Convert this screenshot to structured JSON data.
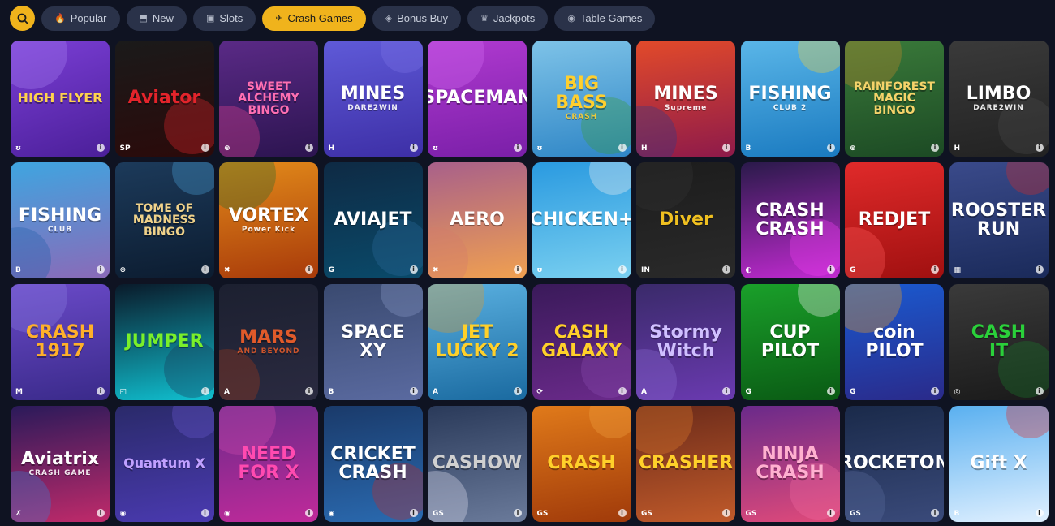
{
  "toolbar": {
    "search_icon": "search-icon",
    "tabs": [
      {
        "label": "Popular",
        "icon": "flame-icon",
        "glyph": "🔥",
        "active": false
      },
      {
        "label": "New",
        "icon": "new-badge-icon",
        "glyph": "⬒",
        "active": false
      },
      {
        "label": "Slots",
        "icon": "slots-icon",
        "glyph": "▣",
        "active": false
      },
      {
        "label": "Crash Games",
        "icon": "plane-icon",
        "glyph": "✈",
        "active": true
      },
      {
        "label": "Bonus Buy",
        "icon": "bonus-icon",
        "glyph": "◈",
        "active": false
      },
      {
        "label": "Jackpots",
        "icon": "jackpot-icon",
        "glyph": "♛",
        "active": false
      },
      {
        "label": "Table Games",
        "icon": "table-icon",
        "glyph": "◉",
        "active": false
      }
    ],
    "accent": "#f0b31c"
  },
  "games": [
    {
      "title": "HIGH FLYER",
      "provider": "ʊ",
      "bg": "linear-gradient(160deg,#7b3fd6,#4b1f99)",
      "fg": "#ffd34d",
      "deco": "#a57ff2"
    },
    {
      "title": "Aviator",
      "sub": "",
      "provider": "SP",
      "bg": "linear-gradient(170deg,#1a1a1a,#2b0a0a)",
      "fg": "#e3242b",
      "deco": "#e3242b"
    },
    {
      "title": "SWEET\nALCHEMY\nBINGO",
      "provider": "⊛",
      "bg": "linear-gradient(170deg,#5a2a86,#2c1450)",
      "fg": "#ff6fb2",
      "deco": "#e84393"
    },
    {
      "title": "MINES",
      "sub": "DARE2WIN",
      "provider": "H",
      "bg": "linear-gradient(170deg,#5f5ad8,#3d2fa6)",
      "fg": "#ffffff",
      "deco": "#7a74e6"
    },
    {
      "title": "SPACEMAN",
      "provider": "ʊ",
      "bg": "linear-gradient(170deg,#b03ad0,#7a1fa8)",
      "fg": "#ffffff",
      "deco": "#d06af0"
    },
    {
      "title": "BIG BASS",
      "sub": "CRASH",
      "provider": "ʊ",
      "bg": "linear-gradient(170deg,#7ec3e8,#2f86c6)",
      "fg": "#ffcf2e",
      "deco": "#3a9a3a"
    },
    {
      "title": "MINES",
      "sub": "Supreme",
      "provider": "H",
      "bg": "linear-gradient(170deg,#e24a2a,#8e1a4a)",
      "fg": "#ffffff",
      "deco": "#2a3a8a"
    },
    {
      "title": "FISHING",
      "sub": "CLUB 2",
      "provider": "B",
      "bg": "linear-gradient(170deg,#5ab6e8,#1a7ac0)",
      "fg": "#ffffff",
      "deco": "#f3d13a"
    },
    {
      "title": "RAINFOREST\nMAGIC\nBINGO",
      "provider": "⊛",
      "bg": "linear-gradient(170deg,#3a7a3a,#1c4a24)",
      "fg": "#f5d36a",
      "deco": "#c48a2a"
    },
    {
      "title": "LIMBO",
      "sub": "DARE2WIN",
      "provider": "H",
      "bg": "linear-gradient(170deg,#3a3a3a,#222222)",
      "fg": "#ffffff",
      "deco": "#4a4a4a"
    },
    {
      "title": "FISHING",
      "sub": "CLUB",
      "provider": "B",
      "bg": "linear-gradient(170deg,#3fa5e0,#8a6ab8)",
      "fg": "#ffffff",
      "deco": "#1f5ea8"
    },
    {
      "title": "TOME OF\nMADNESS\nBINGO",
      "provider": "⊛",
      "bg": "linear-gradient(170deg,#1c3a5a,#0c1c30)",
      "fg": "#f0d28a",
      "deco": "#4aa0d8"
    },
    {
      "title": "VORTEX",
      "sub": "Power Kick",
      "provider": "✖",
      "bg": "linear-gradient(170deg,#e28a1a,#a83a0a)",
      "fg": "#ffffff",
      "deco": "#2a6a2a"
    },
    {
      "title": "AVIAJET",
      "provider": "G",
      "bg": "linear-gradient(170deg,#0e2a44,#0a4a6a)",
      "fg": "#ffffff",
      "deco": "#2a6a9a"
    },
    {
      "title": "AERO",
      "provider": "✖",
      "bg": "linear-gradient(170deg,#a8608a,#f0a050)",
      "fg": "#ffffff",
      "deco": "#d47a6a"
    },
    {
      "title": "CHICKEN+",
      "provider": "ʊ",
      "bg": "linear-gradient(170deg,#2a9ae0,#7ad0f0)",
      "fg": "#ffffff",
      "deco": "#f2f2f2"
    },
    {
      "title": "Diver",
      "provider": "IN",
      "bg": "linear-gradient(170deg,#1c1c1c,#2a2a2a)",
      "fg": "#f0c020",
      "deco": "#333333"
    },
    {
      "title": "CRASH\nCRASH",
      "provider": "◐",
      "bg": "linear-gradient(170deg,#2a1a4a,#c02ad0)",
      "fg": "#ffffff",
      "deco": "#f040f0"
    },
    {
      "title": "REDJET",
      "provider": "G",
      "bg": "linear-gradient(170deg,#e02a2a,#a01010)",
      "fg": "#ffffff",
      "deco": "#ff5a5a"
    },
    {
      "title": "ROOSTER\nRUN",
      "provider": "▦",
      "bg": "linear-gradient(170deg,#3a4a8a,#1a2a5a)",
      "fg": "#ffffff",
      "deco": "#d02a2a"
    },
    {
      "title": "CRASH\n1917",
      "provider": "M",
      "bg": "linear-gradient(170deg,#6a4ac8,#3a2a8a)",
      "fg": "#ffb02a",
      "deco": "#8a7ae0"
    },
    {
      "title": "JUMPER",
      "provider": "◰",
      "bg": "linear-gradient(170deg,#0a1a2a,#10c0d0)",
      "fg": "#7af02a",
      "deco": "#1a3a5a"
    },
    {
      "title": "MARS",
      "sub": "AND BEYOND",
      "provider": "A",
      "bg": "linear-gradient(170deg,#1c2030,#2a2a40)",
      "fg": "#e05a2a",
      "deco": "#a03a1a"
    },
    {
      "title": "SPACE XY",
      "provider": "B",
      "bg": "linear-gradient(170deg,#3a4a70,#5a6aa0)",
      "fg": "#ffffff",
      "deco": "#8a9ac8"
    },
    {
      "title": "JET\nLUCKY 2",
      "provider": "A",
      "bg": "linear-gradient(170deg,#5ab0e0,#1a6aa0)",
      "fg": "#ffd02a",
      "deco": "#e09a2a"
    },
    {
      "title": "CASH\nGALAXY",
      "provider": "⟳",
      "bg": "linear-gradient(170deg,#3a1a5a,#6a2a8a)",
      "fg": "#ffd02a",
      "deco": "#8a4ab0"
    },
    {
      "title": "Stormy\nWitch",
      "provider": "A",
      "bg": "linear-gradient(170deg,#3a2a6a,#6a3ab0)",
      "fg": "#d0c0ff",
      "deco": "#8a6ad0"
    },
    {
      "title": "CUP\nPILOT",
      "provider": "G",
      "bg": "linear-gradient(170deg,#1aa02a,#0a5a14)",
      "fg": "#ffffff",
      "deco": "#f2f2f2"
    },
    {
      "title": "coin\nPILOT",
      "provider": "G",
      "bg": "linear-gradient(170deg,#1a5ad0,#2a2a8a)",
      "fg": "#ffffff",
      "deco": "#f0a020"
    },
    {
      "title": "CASH\nIT",
      "provider": "◎",
      "bg": "linear-gradient(170deg,#3a3a3a,#1a1a1a)",
      "fg": "#2ad03a",
      "deco": "#1a7a2a"
    },
    {
      "title": "Aviatrix",
      "sub": "CRASH GAME",
      "provider": "✗",
      "bg": "linear-gradient(170deg,#2a1a5a,#c02a6a)",
      "fg": "#ffffff",
      "deco": "#3a7ad0"
    },
    {
      "title": "Quantum X",
      "provider": "◉",
      "bg": "linear-gradient(170deg,#2a2a6a,#4a3ab0)",
      "fg": "#c0a0ff",
      "deco": "#6a5ad0"
    },
    {
      "title": "NEED\nFOR X",
      "provider": "◉",
      "bg": "linear-gradient(170deg,#6a2a8a,#c02a9a)",
      "fg": "#ff4ab0",
      "deco": "#d04ab0"
    },
    {
      "title": "CRICKET\nCRASH",
      "provider": "◉",
      "bg": "linear-gradient(170deg,#1a3a6a,#2a6ab0)",
      "fg": "#ffffff",
      "deco": "#c02a2a"
    },
    {
      "title": "CASHOW",
      "provider": "GS",
      "bg": "linear-gradient(170deg,#2a3a5a,#6a7a9a)",
      "fg": "#d0d0d0",
      "deco": "#e0e0f0"
    },
    {
      "title": "CRASH",
      "provider": "GS",
      "bg": "linear-gradient(170deg,#e07a1a,#a03a0a)",
      "fg": "#ffd02a",
      "deco": "#f0a040"
    },
    {
      "title": "CRASHER",
      "provider": "GS",
      "bg": "linear-gradient(170deg,#6a2a1a,#c05a2a)",
      "fg": "#ffd02a",
      "deco": "#e07a2a"
    },
    {
      "title": "NINJA\nCRASH",
      "provider": "GS",
      "bg": "linear-gradient(170deg,#6a2a8a,#e04a7a)",
      "fg": "#ffb0d0",
      "deco": "#f06aa0"
    },
    {
      "title": "ROCKETON",
      "provider": "GS",
      "bg": "linear-gradient(170deg,#1a2a4a,#3a4a7a)",
      "fg": "#ffffff",
      "deco": "#5a6a9a"
    },
    {
      "title": "Gift X",
      "provider": "B",
      "bg": "linear-gradient(170deg,#5ab0f0,#e0f0ff)",
      "fg": "#ffffff",
      "deco": "#e02a2a"
    }
  ]
}
